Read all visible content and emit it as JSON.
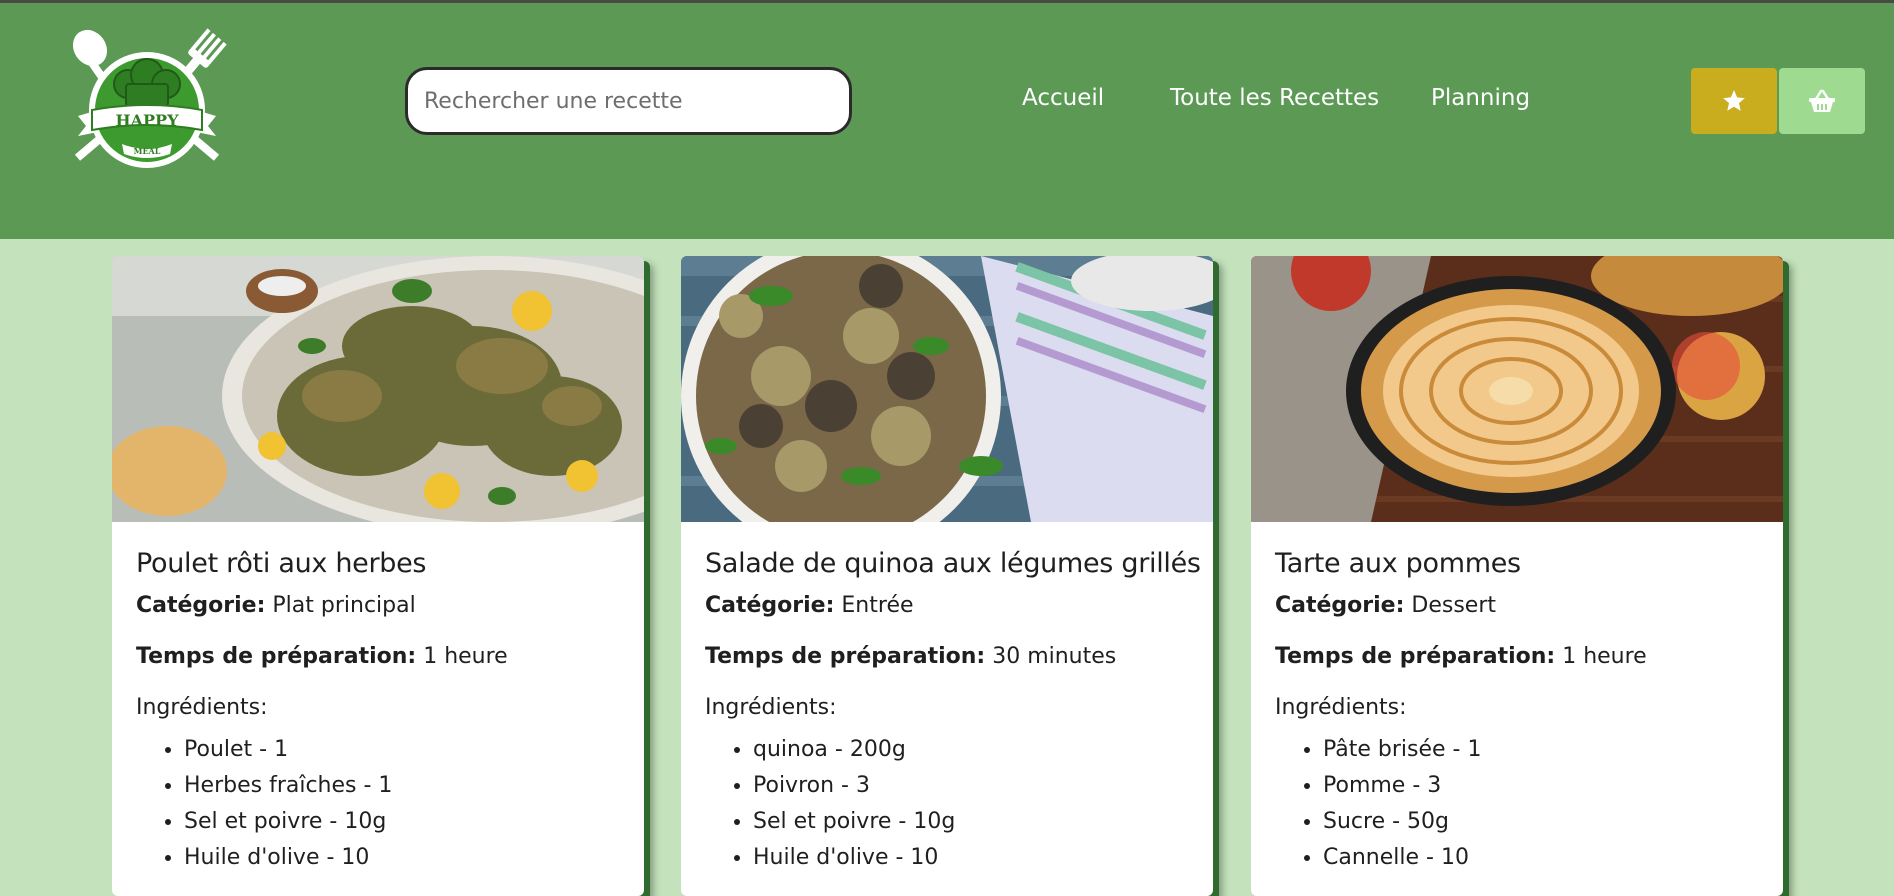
{
  "header": {
    "logo": {
      "top_text": "HAPPY",
      "bottom_text": "MEAL"
    },
    "search": {
      "placeholder": "Rechercher une recette",
      "value": ""
    },
    "nav": [
      {
        "label": "Accueil"
      },
      {
        "label": "Toute les Recettes"
      },
      {
        "label": "Planning"
      }
    ],
    "buttons": {
      "favorites_icon": "star-icon",
      "cart_icon": "basket-icon"
    },
    "colors": {
      "header_bg": "#5b9955",
      "page_bg": "#c4e2bc",
      "fav_button": "#c9ad1e",
      "cart_button": "#9edb91"
    }
  },
  "recipes": [
    {
      "title": "Poulet rôti aux herbes",
      "category_label": "Catégorie:",
      "category": "Plat principal",
      "prep_label": "Temps de préparation:",
      "prep_time": "1 heure",
      "ingredients_label": "Ingrédients:",
      "ingredients": [
        "Poulet - 1",
        "Herbes fraîches - 1",
        "Sel et poivre - 10g",
        "Huile d'olive - 10"
      ]
    },
    {
      "title": "Salade de quinoa aux légumes grillés",
      "category_label": "Catégorie:",
      "category": "Entrée",
      "prep_label": "Temps de préparation:",
      "prep_time": "30 minutes",
      "ingredients_label": "Ingrédients:",
      "ingredients": [
        "quinoa - 200g",
        "Poivron - 3",
        "Sel et poivre - 10g",
        "Huile d'olive - 10"
      ]
    },
    {
      "title": "Tarte aux pommes",
      "category_label": "Catégorie:",
      "category": "Dessert",
      "prep_label": "Temps de préparation:",
      "prep_time": "1 heure",
      "ingredients_label": "Ingrédients:",
      "ingredients": [
        "Pâte brisée - 1",
        "Pomme - 3",
        "Sucre - 50g",
        "Cannelle - 10"
      ]
    }
  ]
}
